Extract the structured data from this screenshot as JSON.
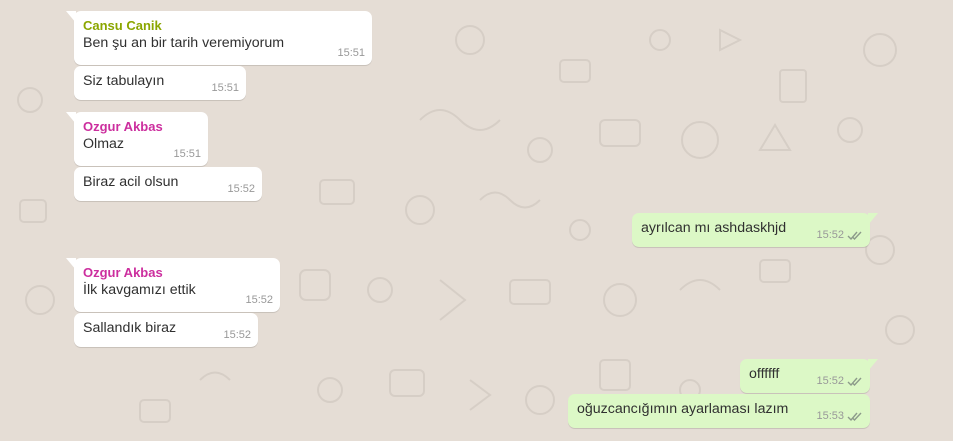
{
  "colors": {
    "background": "#e5ddd5",
    "incoming_bubble": "#ffffff",
    "outgoing_bubble": "#dcf8c6",
    "sender_cansu": "#8ba600",
    "sender_ozgur": "#cc2e9e",
    "timestamp": "#999999",
    "read_ticks": "#8c9a8a"
  },
  "icons": {
    "read_receipt": "double-check-icon"
  },
  "messages": [
    {
      "direction": "incoming",
      "sender": "Cansu Canik",
      "text": "Ben şu an bir tarih veremiyorum",
      "time": "15:51"
    },
    {
      "direction": "incoming",
      "text": "Siz tabulayın",
      "time": "15:51"
    },
    {
      "direction": "incoming",
      "sender": "Ozgur Akbas",
      "text": "Olmaz",
      "time": "15:51"
    },
    {
      "direction": "incoming",
      "text": "Biraz acil olsun",
      "time": "15:52"
    },
    {
      "direction": "outgoing",
      "text": "ayrılcan mı ashdaskhjd",
      "time": "15:52",
      "read": true
    },
    {
      "direction": "incoming",
      "sender": "Ozgur Akbas",
      "text": "İlk kavgamızı ettik",
      "time": "15:52"
    },
    {
      "direction": "incoming",
      "text": "Sallandık biraz",
      "time": "15:52"
    },
    {
      "direction": "outgoing",
      "text": "offffff",
      "time": "15:52",
      "read": true
    },
    {
      "direction": "outgoing",
      "text": "oğuzcancığımın ayarlaması lazım",
      "time": "15:53",
      "read": true
    }
  ]
}
